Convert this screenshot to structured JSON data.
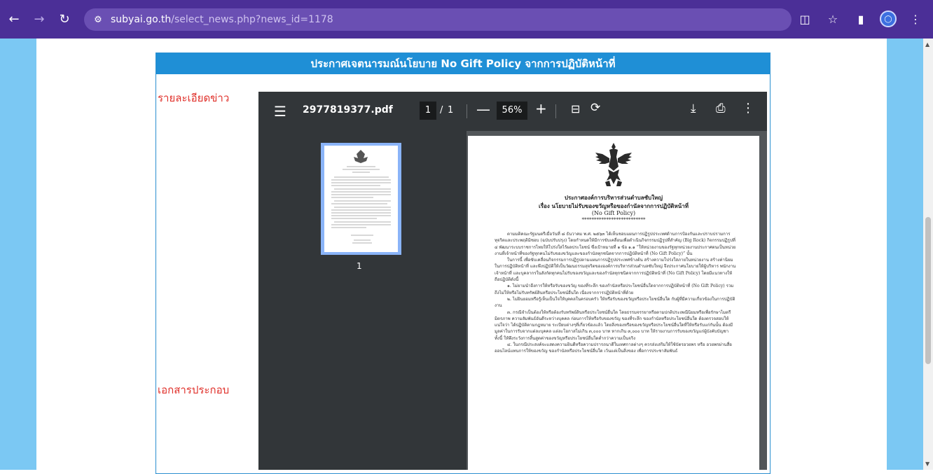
{
  "browser": {
    "url_domain": "subyai.go.th",
    "url_path": "/select_news.php?news_id=1178"
  },
  "news": {
    "title": "ประกาศเจตนารมณ์นโยบาย No Gift Policy จากการปฏิบัติหน้าที่",
    "detail_label": "รายละเอียดข่าว",
    "attachment_label": "เอกสารประกอบ"
  },
  "pdf": {
    "filename": "2977819377.pdf",
    "page_current": "1",
    "page_sep": "/",
    "page_total": "1",
    "zoom": "56%",
    "thumbnail_label": "1",
    "doc": {
      "org": "ประกาศองค์การบริหารส่วนตำบลซับใหญ่",
      "subject": "เรื่อง  นโยบายไม่รับของขวัญหรือของกำนัลจากการปฏิบัติหน้าที่",
      "subtitle": "(No Gift Policy)",
      "stars": "**************************",
      "para1": "ตามมติคณะรัฐมนตรีเมื่อวันที่ ๘ ธันวาคม พ.ศ. ๒๕๖๓ ได้เห็นชอบแผนการปฏิรูปประเทศด้านการป้องกันและปราบปรามการทุจริตและประพฤติมิชอบ (ฉบับปรับปรุง) โดยกำหนดให้มีการขับเคลื่อนเพื่อดำเนินกิจกรรมปฏิรูปที่สำคัญ (Big Rock) กิจกรรมปฏิรูปที่ ๔ พัฒนาระบบราชการไทยให้โปร่งใสไร้ผลประโยชน์ ซึ่งเป้าหมายที่ ๑ ข้อ ๑.๑ “ให้หน่วยงานของรัฐทุกหน่วยงานประกาศตนเป็นหน่วยงานที่เจ้าหน้าที่ของรัฐทุกคนไม่รับของขวัญและของกำนัลทุกชนิดจากการปฏิบัติหน้าที่ (No Gift Policy)” นั้น",
      "para2": "ในการนี้ เพื่อขับเคลื่อนกิจกรรมการปฏิรูปตามแผนการปฏิรูปประเทศข้างต้น สร้างความโปร่งใสภายในหน่วยงาน สร้างค่านิยมในการปฏิบัติหน้าที่ และพึงปฏิบัติให้เป็นวัฒนธรรมสุจริตขององค์การบริหารส่วนตำบลซับใหญ่ จึงประกาศนโยบายให้ผู้บริหาร พนักงาน เจ้าหน้าที่ และบุคลากรในสังกัดทุกคนไม่รับของขวัญและของกำนัลทุกชนิดจากการปฏิบัติหน้าที่ (No Gift Policy) โดยมีแนวทางให้ถือปฏิบัติดังนี้",
      "para3": "๑. ไม่ยามนำอีงการให้หรือรับของขวัญ ของที่ระลึก ของกำนัลหรือประโยชน์อื่นใดจากการปฏิบัติหน้าที่ (No Gift Policy) รวมถึงไม่ให้หรือไม่รับทรัพย์สินหรือประโยชน์อื่นใด เนื่องจากการปฏิบัติหน้าที่ด้วย",
      "para4": "๒. ไม่ยินยอมหรือรู้เห็นเป็นใจให้บุคคลในครอบครัว ให้หรือรับของขวัญหรือประโยชน์อื่นใด กับผู้ที่มีความเกี่ยวข้องในการปฏิบัติงาน",
      "para5": "๓. กรณีจำเป็นต้องให้หรือต้องรับทรัพย์สินหรือประโยชน์อื่นใด โดยธรรมจรรยาหรือตามปกติประเพณีนิยมหรือเพื่อรักษาไมตรี มิตรภาพ ความสัมพันธ์อันดีระหว่างบุคคล ก่อนการให้หรือรับของขวัญ ของที่ระลึก ของกำนัลหรือประโยชน์อื่นใด ต้องตรวจสอบให้แน่ใจว่า ได้ปฏิบัติตามกฎหมาย ระเบียบต่างๆที่เกี่ยวข้องแล้ว โดยสิ่งของหรือของขวัญหรือประโยชน์อื่นใดที่ให้หรือรับแก่กันนั้น ต้องมีมูลค่าในการรับจากแต่ละบุคคล แต่ละโอกาสไม่เกิน ๓,๐๐๐ บาท หากเกิน ๓,๐๐๐ บาท ให้รายงานการรับของขวัญแก่ผู้บังคับบัญชา ทั้งนี้ ให้พึงระวังการสิ้นสูดค่าของขวัญหรือประโยชน์อื่นใดต่ำกว่าความเป็นจริง",
      "para6": "๔. ในกรณีประสงค์จะแสดงความยินดีหรือความปรารถนาดีในเทศกาลต่างๆ ควรส่งเสริมให้ใช้บัตรอวยพร หรือ อวยพรผ่านสื่อออนไลน์แทนการให้ของขวัญ ของกำนัลหรือประโยชน์อื่นใด เว้นแต่เป็นสิ่งของ เพื่อการประชาสัมพันธ์"
    }
  }
}
